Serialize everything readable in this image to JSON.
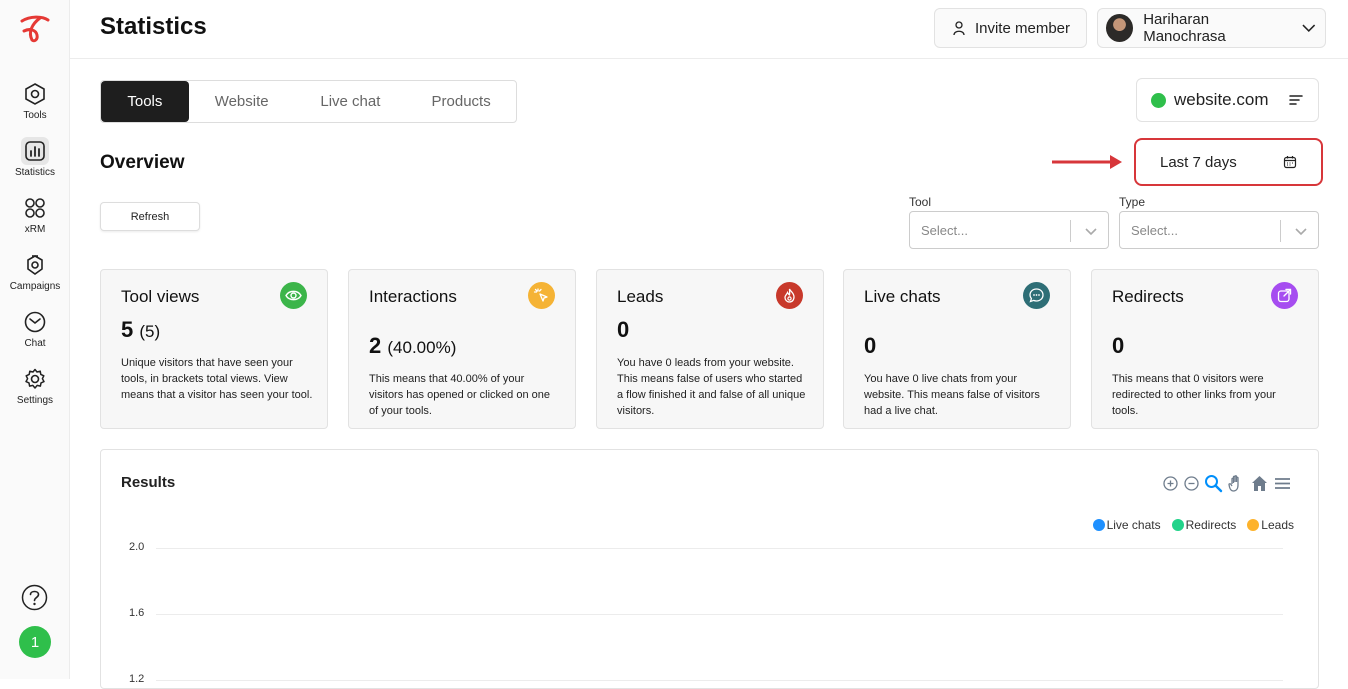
{
  "app": {
    "title": "Statistics"
  },
  "sidebar": {
    "items": [
      {
        "label": "Tools",
        "icon": "hexagon-gear-icon",
        "active": false
      },
      {
        "label": "Statistics",
        "icon": "bar-chart-icon",
        "active": true
      },
      {
        "label": "xRM",
        "icon": "grid-icon",
        "active": false
      },
      {
        "label": "Campaigns",
        "icon": "campaign-icon",
        "active": false
      },
      {
        "label": "Chat",
        "icon": "mail-icon",
        "active": false
      },
      {
        "label": "Settings",
        "icon": "gear-icon",
        "active": false
      }
    ],
    "user_badge": "1"
  },
  "header": {
    "invite_label": "Invite member",
    "user_name": "Hariharan Manochrasa"
  },
  "tabs": [
    {
      "label": "Tools",
      "active": true
    },
    {
      "label": "Website",
      "active": false
    },
    {
      "label": "Live chat",
      "active": false
    },
    {
      "label": "Products",
      "active": false
    }
  ],
  "website": {
    "name": "website.com"
  },
  "overview": {
    "title": "Overview",
    "date_range": "Last 7 days",
    "refresh_label": "Refresh"
  },
  "filters": {
    "tool": {
      "label": "Tool",
      "placeholder": "Select..."
    },
    "type": {
      "label": "Type",
      "placeholder": "Select..."
    }
  },
  "cards": [
    {
      "title": "Tool views",
      "value": "5",
      "sub": "(5)",
      "desc": "Unique visitors that have seen your tools, in brackets total views. View means that a visitor has seen your tool.",
      "icon": "eye-icon",
      "color": "#3cb54a"
    },
    {
      "title": "Interactions",
      "value": "2",
      "sub": "(40.00%)",
      "desc": "This means that 40.00% of your visitors has opened or clicked on one of your tools.",
      "icon": "click-icon",
      "color": "#f5b335"
    },
    {
      "title": "Leads",
      "value": "0",
      "sub": "",
      "desc": "You have 0 leads from your website. This means false of users who started a flow finished it and false of all unique visitors.",
      "icon": "fire-icon",
      "color": "#c8392b"
    },
    {
      "title": "Live chats",
      "value": "0",
      "sub": "",
      "desc": "You have 0 live chats from your website. This means false of visitors had a live chat.",
      "icon": "chat-bubble-icon",
      "color": "#2e6e76"
    },
    {
      "title": "Redirects",
      "value": "0",
      "sub": "",
      "desc": "This means that 0 visitors were redirected to other links from your tools.",
      "icon": "external-link-icon",
      "color": "#a64df0"
    }
  ],
  "results": {
    "title": "Results"
  },
  "chart_data": {
    "type": "line",
    "title": "Results",
    "series": [
      {
        "name": "Live chats",
        "color": "#1e90ff",
        "values": []
      },
      {
        "name": "Redirects",
        "color": "#22d38a",
        "values": []
      },
      {
        "name": "Leads",
        "color": "#fdb22b",
        "values": []
      }
    ],
    "y_ticks": [
      "2.0",
      "1.6",
      "1.2"
    ],
    "legend_position": "top-right",
    "grid": true
  }
}
